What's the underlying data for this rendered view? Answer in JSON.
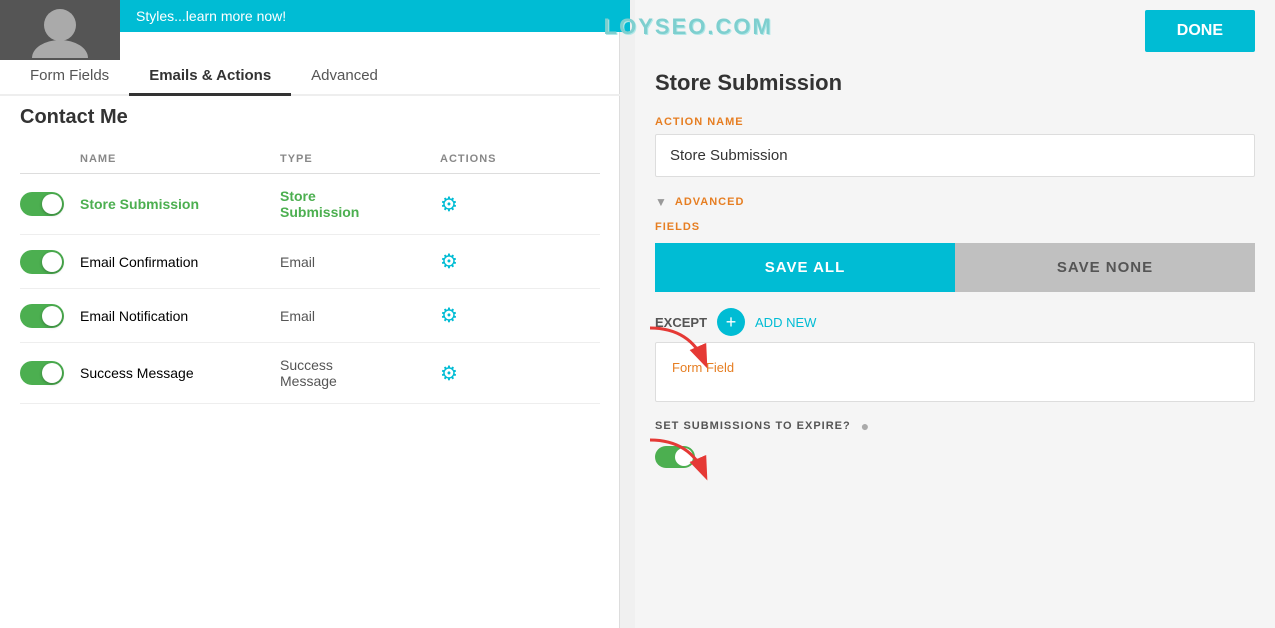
{
  "watermark": "LOYSEO.COM",
  "banner": {
    "text": "Styles...learn more now!"
  },
  "done_button": "DONE",
  "tabs": [
    {
      "label": "Form Fields",
      "active": false
    },
    {
      "label": "Emails & Actions",
      "active": true
    },
    {
      "label": "Advanced",
      "active": false
    }
  ],
  "page_title": "Contact Me",
  "table": {
    "headers": [
      "NAME",
      "TYPE",
      "ACTIONS"
    ],
    "rows": [
      {
        "name": "Store Submission",
        "type": "Store\nSubmission",
        "active": true
      },
      {
        "name": "Email Confirmation",
        "type": "Email",
        "active": true
      },
      {
        "name": "Email Notification",
        "type": "Email",
        "active": true
      },
      {
        "name": "Success Message",
        "type": "Success\nMessage",
        "active": true
      }
    ]
  },
  "right_panel": {
    "title": "Store Submission",
    "action_name_label": "ACTION NAME",
    "action_name_value": "Store Submission",
    "advanced_label": "ADVANCED",
    "fields_label": "FIELDS",
    "save_all_label": "SAVE ALL",
    "save_none_label": "SAVE NONE",
    "except_label": "EXCEPT",
    "add_new_label": "ADD NEW",
    "form_field_tag": "Form Field",
    "expire_label": "SET SUBMISSIONS TO EXPIRE?"
  }
}
